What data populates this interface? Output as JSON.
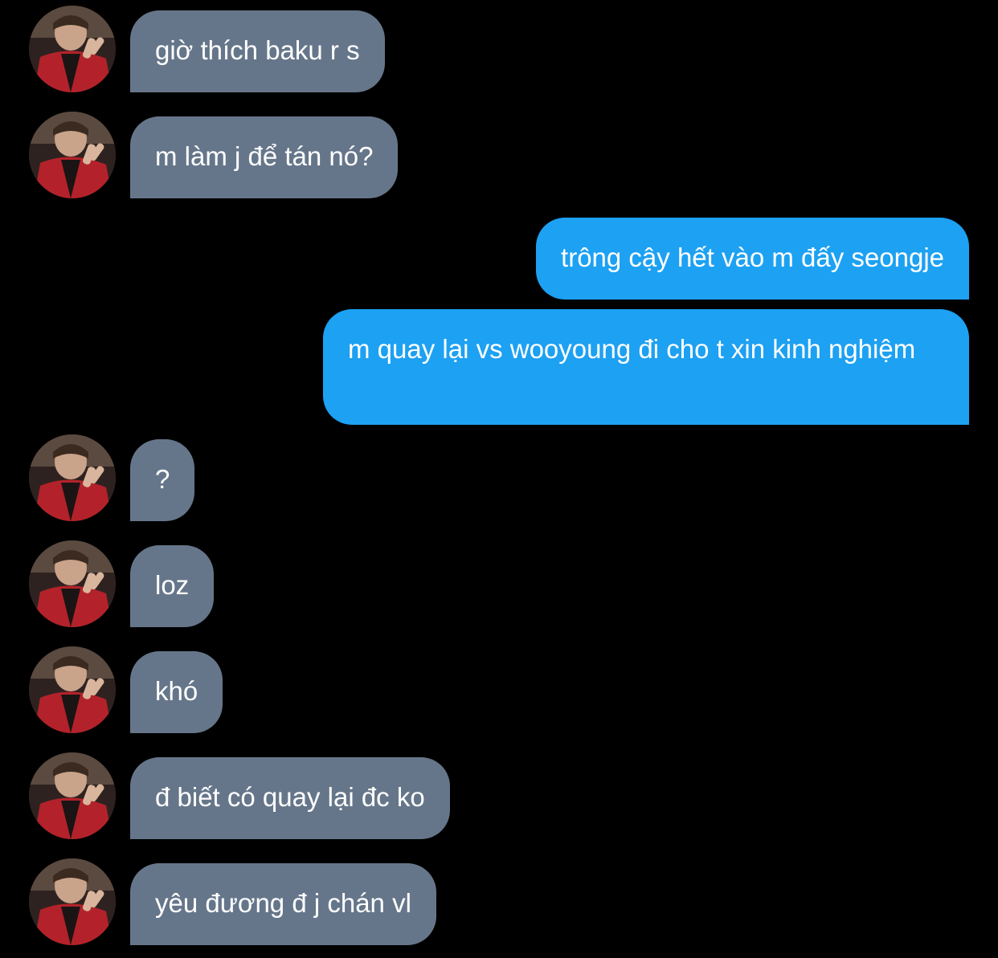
{
  "conversation": {
    "incoming_color": "#66768a",
    "outgoing_color": "#1da1f2",
    "messages": [
      {
        "side": "incoming",
        "text": "giờ thích baku r s",
        "avatar_icon": "contact-avatar"
      },
      {
        "side": "incoming",
        "text": "m làm j để tán nó?",
        "avatar_icon": "contact-avatar"
      },
      {
        "side": "outgoing",
        "text": "trông cậy hết vào m đấy seongje"
      },
      {
        "side": "outgoing",
        "text": "m quay lại vs wooyoung đi cho t xin kinh nghiệm"
      },
      {
        "side": "incoming",
        "text": "?",
        "avatar_icon": "contact-avatar"
      },
      {
        "side": "incoming",
        "text": "loz",
        "avatar_icon": "contact-avatar"
      },
      {
        "side": "incoming",
        "text": "khó",
        "avatar_icon": "contact-avatar"
      },
      {
        "side": "incoming",
        "text": "đ biết có quay lại đc ko",
        "avatar_icon": "contact-avatar"
      },
      {
        "side": "incoming",
        "text": "yêu đương đ j chán vl",
        "avatar_icon": "contact-avatar"
      }
    ]
  }
}
